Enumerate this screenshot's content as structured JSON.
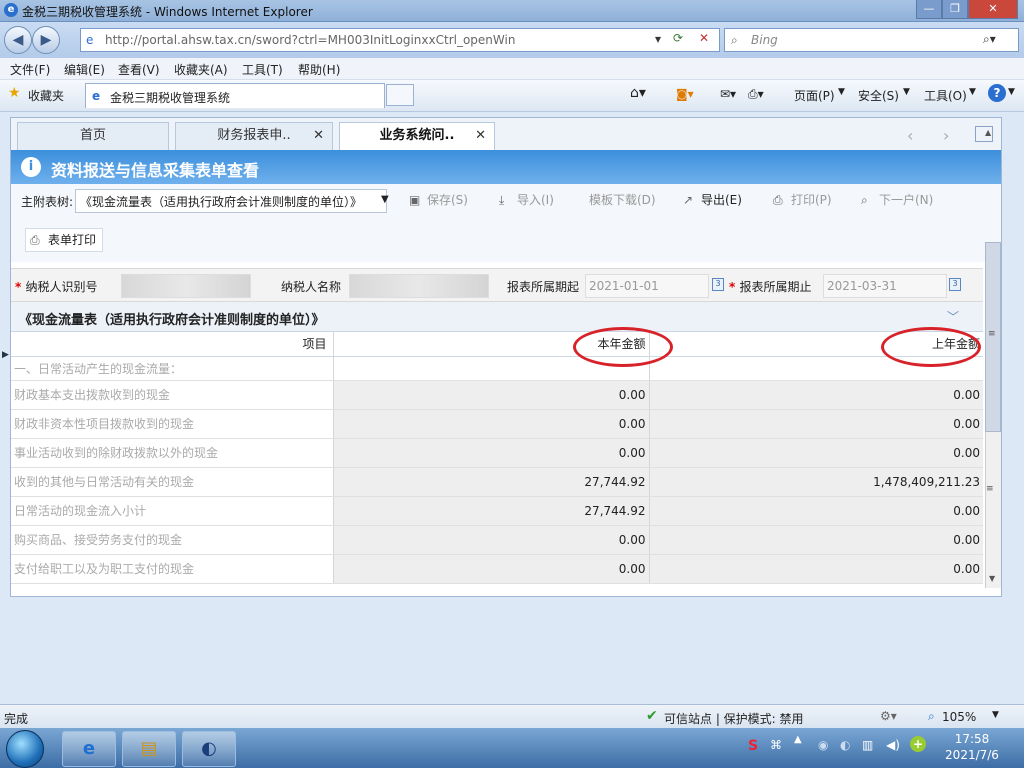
{
  "window": {
    "title": "金税三期税收管理系统 - Windows Internet Explorer"
  },
  "address": {
    "url": "http://portal.ahsw.tax.cn/sword?ctrl=MH003InitLoginxxCtrl_openWin",
    "search_placeholder": "Bing"
  },
  "menu": [
    "文件(F)",
    "编辑(E)",
    "查看(V)",
    "收藏夹(A)",
    "工具(T)",
    "帮助(H)"
  ],
  "favbar": {
    "favorites": "收藏夹",
    "tab": "金税三期税收管理系统",
    "tools": [
      "页面(P)",
      "安全(S)",
      "工具(O)"
    ]
  },
  "app_tabs": [
    {
      "label": "首页"
    },
    {
      "label": "财务报表申.."
    },
    {
      "label": "业务系统问.."
    }
  ],
  "page_title": "资料报送与信息采集表单查看",
  "toolbar": {
    "main_label": "主附表树:",
    "combo_value": "《现金流量表（适用执行政府会计准则制度的单位）》",
    "save": "保存(S)",
    "import": "导入(I)",
    "template": "模板下载(D)",
    "export": "导出(E)",
    "print": "打印(P)",
    "next": "下一户(N)",
    "form_print": "表单打印"
  },
  "info": {
    "taxpayer_id_label": "纳税人识别号",
    "taxpayer_name_label": "纳税人名称",
    "period_start_label": "报表所属期起",
    "period_start": "2021-01-01",
    "period_end_label": "报表所属期止",
    "period_end": "2021-03-31"
  },
  "form_title": "《现金流量表（适用执行政府会计准则制度的单位）》",
  "table": {
    "headers": [
      "项目",
      "本年金额",
      "上年金额"
    ],
    "section": "一、日常活动产生的现金流量：",
    "rows": [
      {
        "item": "财政基本支出拨款收到的现金",
        "current": "0.00",
        "previous": "0.00"
      },
      {
        "item": "财政非资本性项目拨款收到的现金",
        "current": "0.00",
        "previous": "0.00"
      },
      {
        "item": "事业活动收到的除财政拨款以外的现金",
        "current": "0.00",
        "previous": "0.00"
      },
      {
        "item": "收到的其他与日常活动有关的现金",
        "current": "27,744.92",
        "previous": "1,478,409,211.23"
      },
      {
        "item": "日常活动的现金流入小计",
        "current": "27,744.92",
        "previous": "0.00"
      },
      {
        "item": "购买商品、接受劳务支付的现金",
        "current": "0.00",
        "previous": "0.00"
      },
      {
        "item": "支付给职工以及为职工支付的现金",
        "current": "0.00",
        "previous": "0.00"
      }
    ]
  },
  "status": {
    "left": "完成",
    "zone": "可信站点 | 保护模式: 禁用",
    "zoom": "105%"
  },
  "taskbar": {
    "time": "17:58",
    "date": "2021/7/6"
  }
}
